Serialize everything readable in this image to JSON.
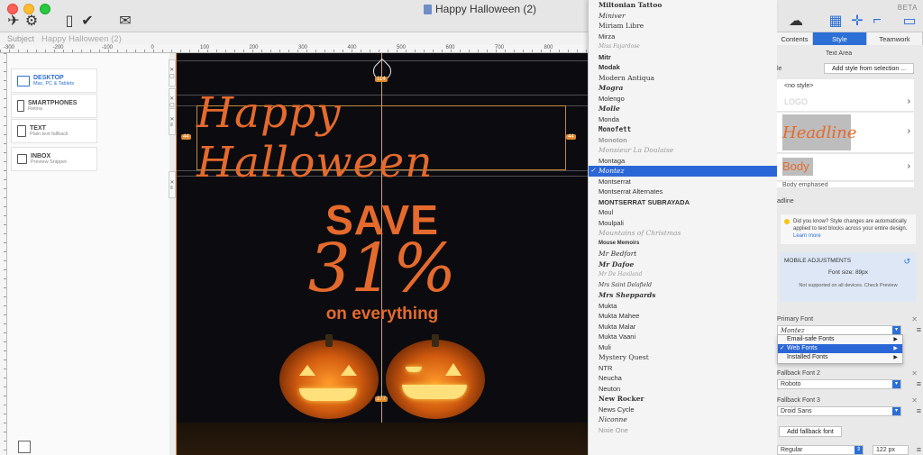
{
  "window": {
    "title": "Happy Halloween (2)",
    "beta": "BETA"
  },
  "subject": {
    "label": "Subject",
    "value": "Happy Halloween (2)"
  },
  "ruler": {
    "labels": [
      "-300",
      "-200",
      "-100",
      "0",
      "100",
      "200",
      "300",
      "400",
      "500",
      "600",
      "700",
      "800",
      "900"
    ]
  },
  "devices": [
    {
      "name": "DESKTOP",
      "sub": "Mac, PC & Tablets",
      "active": true
    },
    {
      "name": "SMARTPHONES",
      "sub": "Retina",
      "active": false
    },
    {
      "name": "TEXT",
      "sub": "Plain text fallback",
      "active": false
    },
    {
      "name": "INBOX",
      "sub": "Preview Snippet",
      "active": false
    }
  ],
  "canvas": {
    "headline": "Happy Halloween",
    "save_line1": "SAVE",
    "save_line2": "31%",
    "save_line3": "on everything",
    "pin_top": "114",
    "pin_left": "44",
    "pin_right": "44",
    "pin_bottom": "277",
    "colors": {
      "accent": "#e56a2d",
      "guide": "#e08a2a",
      "background": "#0c0c10"
    }
  },
  "fontmenu": {
    "selected": "Montez",
    "items": [
      "Miltonian Tattoo",
      "Miniver",
      "Miriam Libre",
      "Mirza",
      "Miss Fajardose",
      "Mitr",
      "Modak",
      "Modern Antiqua",
      "Mogra",
      "Molengo",
      "Molle",
      "Monda",
      "Monofett",
      "Monoton",
      "Monsieur La Doulaise",
      "Montaga",
      "Montez",
      "Montserrat",
      "Montserrat Alternates",
      "MONTSERRAT SUBRAYADA",
      "Moul",
      "Moulpali",
      "Mountains of Christmas",
      "Mouse Memoirs",
      "Mr Bedfort",
      "Mr Dafoe",
      "Mr De Haviland",
      "Mrs Saint Delafield",
      "Mrs Sheppards",
      "Mukta",
      "Mukta Mahee",
      "Mukta Malar",
      "Mukta Vaani",
      "Muli",
      "Mystery Quest",
      "NTR",
      "Neucha",
      "Neuton",
      "New Rocker",
      "News Cycle",
      "Niconne",
      "Nixie One"
    ]
  },
  "rightpanel": {
    "tabs": [
      "Contents",
      "Style",
      "Teamwork"
    ],
    "active_tab": "Style",
    "text_area_label": "Text Area",
    "style_label": "le",
    "add_style_button": "Add style from selection ...",
    "styles": [
      "<no style>",
      "LOGO",
      "Headline",
      "Body",
      "Body emphased"
    ],
    "section_headline": "adline",
    "tip": "Did you know? Style changes are automatically applied to text blocks across your entire design.",
    "tip_link": "Learn more",
    "mobile_title": "MOBILE ADJUSTMENTS",
    "font_size_label": "Font size:",
    "font_size_value": "89px",
    "not_supported": "Not supported on all devices. Check Preview",
    "primary_font_label": "Primary Font",
    "primary_font_value": "Montez",
    "submenu": [
      {
        "label": "Email-safe Fonts",
        "selected": false
      },
      {
        "label": "Web Fonts",
        "selected": true
      },
      {
        "label": "Installed Fonts",
        "selected": false
      }
    ],
    "fallback2_label": "Fallback Font 2",
    "fallback2_value": "Roboto",
    "fallback3_label": "Fallback Font 3",
    "fallback3_value": "Droid Sans",
    "add_fallback_button": "Add fallback font",
    "weight_value": "Regular",
    "size_value": "122 px"
  }
}
